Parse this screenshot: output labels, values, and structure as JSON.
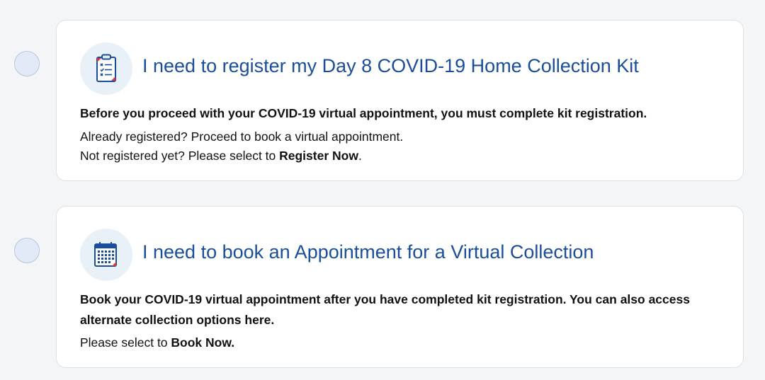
{
  "options": [
    {
      "icon": "clipboard-checklist-icon",
      "title": "I need to register my Day 8 COVID-19 Home Collection Kit",
      "lead": "Before you proceed with your COVID-19 virtual appointment, you must complete kit registration.",
      "line1": "Already registered? Proceed to book a virtual appointment.",
      "line2_prefix": "Not registered yet? Please select to ",
      "line2_bold": "Register Now",
      "line2_suffix": "."
    },
    {
      "icon": "calendar-icon",
      "title": "I need to book an Appointment for a Virtual Collection",
      "lead": "Book your COVID-19 virtual appointment after you have completed kit registration. You can also access alternate collection options here.",
      "line1_prefix": "Please select to ",
      "line1_bold": "Book Now."
    }
  ],
  "colors": {
    "title": "#1a4e9c",
    "background": "#f3f5f6",
    "radio_fill": "#e3eaf7",
    "icon_bg": "#e8f0f8",
    "icon_accent": "#d9363e"
  }
}
